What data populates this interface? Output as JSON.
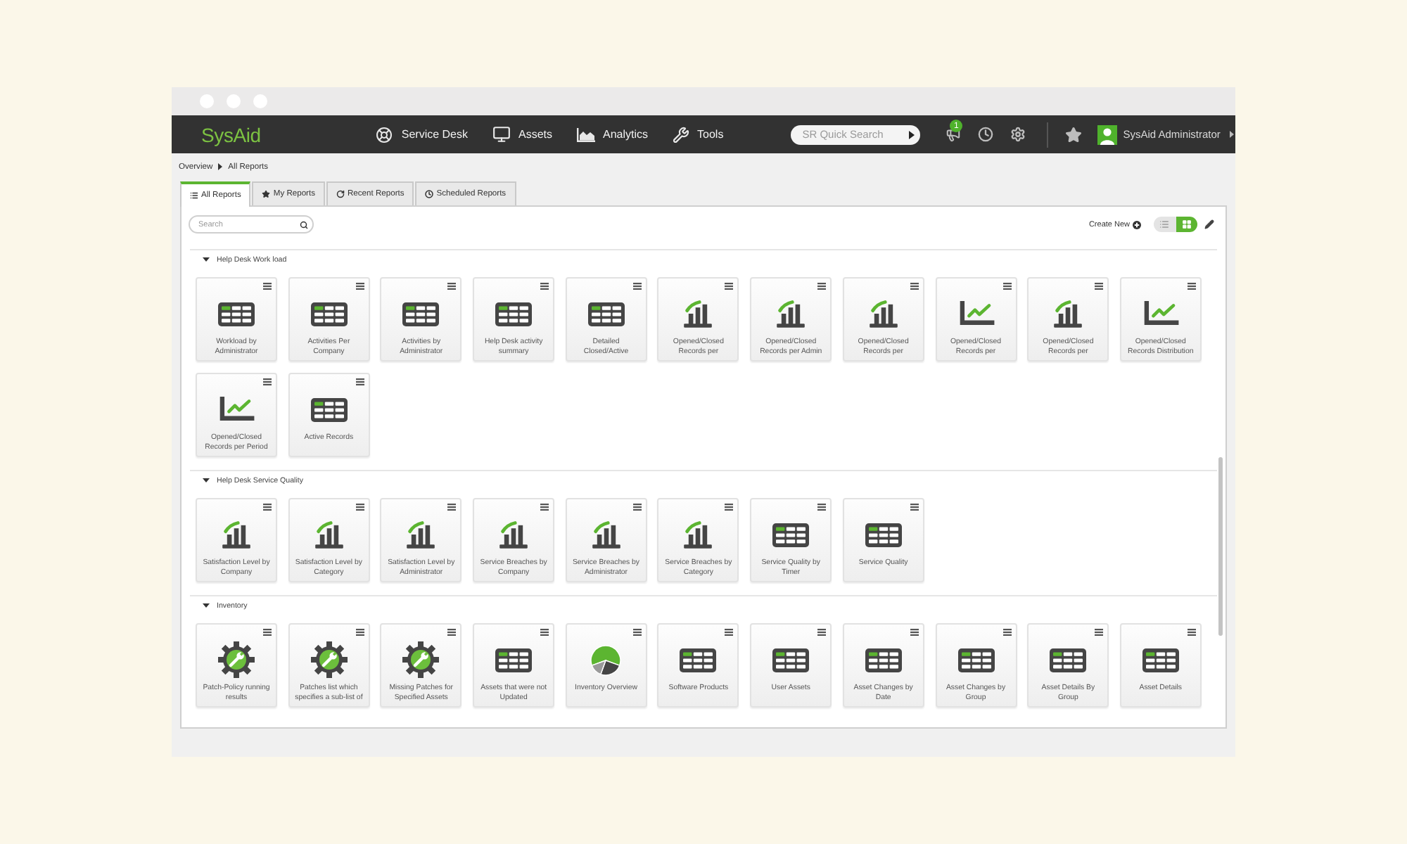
{
  "navbar": {
    "logo": "SysAid",
    "items": [
      {
        "label": "Service Desk"
      },
      {
        "label": "Assets"
      },
      {
        "label": "Analytics"
      },
      {
        "label": "Tools"
      }
    ],
    "search": {
      "placeholder": "SR Quick Search"
    },
    "notifications": {
      "count": "1"
    },
    "user": {
      "name": "SysAid Administrator"
    }
  },
  "breadcrumb": [
    "Overview",
    "All Reports"
  ],
  "tabs": [
    {
      "label": "All Reports",
      "selected": true
    },
    {
      "label": "My Reports",
      "selected": false
    },
    {
      "label": "Recent Reports",
      "selected": false
    },
    {
      "label": "Scheduled Reports",
      "selected": false
    }
  ],
  "toolbar": {
    "search": {
      "placeholder": "Search"
    },
    "create_new": "Create New",
    "view_toggle": [
      {
        "kind": "list",
        "selected": false
      },
      {
        "kind": "grid",
        "selected": true
      }
    ]
  },
  "sections": [
    {
      "title": "Help Desk Work load",
      "expanded": true,
      "reports": [
        {
          "kind": "table",
          "title": "Workload by Administrator"
        },
        {
          "kind": "table",
          "title": "Activities Per Company"
        },
        {
          "kind": "table",
          "title": "Activities by Administrator"
        },
        {
          "kind": "table",
          "title": "Help Desk activity summary"
        },
        {
          "kind": "table",
          "title": "Detailed Closed/Active"
        },
        {
          "kind": "bar",
          "title": "Opened/Closed Records per"
        },
        {
          "kind": "bar",
          "title": "Opened/Closed Records per Admin"
        },
        {
          "kind": "bar",
          "title": "Opened/Closed Records per"
        },
        {
          "kind": "line",
          "title": "Opened/Closed Records per"
        },
        {
          "kind": "bar",
          "title": "Opened/Closed Records per"
        },
        {
          "kind": "line",
          "title": "Opened/Closed Records Distribution"
        },
        {
          "kind": "line",
          "title": "Opened/Closed Records per Period"
        },
        {
          "kind": "table",
          "title": "Active Records"
        }
      ]
    },
    {
      "title": "Help Desk Service Quality",
      "expanded": true,
      "reports": [
        {
          "kind": "bar",
          "title": "Satisfaction Level by Company"
        },
        {
          "kind": "bar",
          "title": "Satisfaction Level by Category"
        },
        {
          "kind": "bar",
          "title": "Satisfaction Level by Administrator"
        },
        {
          "kind": "bar",
          "title": "Service Breaches by Company"
        },
        {
          "kind": "bar",
          "title": "Service Breaches by Administrator"
        },
        {
          "kind": "bar",
          "title": "Service Breaches by Category"
        },
        {
          "kind": "table",
          "title": "Service Quality by Timer"
        },
        {
          "kind": "table",
          "title": "Service Quality"
        }
      ]
    },
    {
      "title": "Inventory",
      "expanded": true,
      "reports": [
        {
          "kind": "gear",
          "title": "Patch-Policy running results"
        },
        {
          "kind": "gear",
          "title": "Patches list which specifies a sub-list of"
        },
        {
          "kind": "gear",
          "title": "Missing Patches for Specified Assets"
        },
        {
          "kind": "table",
          "title": "Assets that were not Updated"
        },
        {
          "kind": "pie",
          "title": "Inventory Overview"
        },
        {
          "kind": "table",
          "title": "Software Products"
        },
        {
          "kind": "table",
          "title": "User Assets"
        },
        {
          "kind": "table",
          "title": "Asset Changes by Date"
        },
        {
          "kind": "table",
          "title": "Asset Changes by Group"
        },
        {
          "kind": "table",
          "title": "Asset Details By Group"
        },
        {
          "kind": "table",
          "title": "Asset Details"
        }
      ]
    }
  ]
}
